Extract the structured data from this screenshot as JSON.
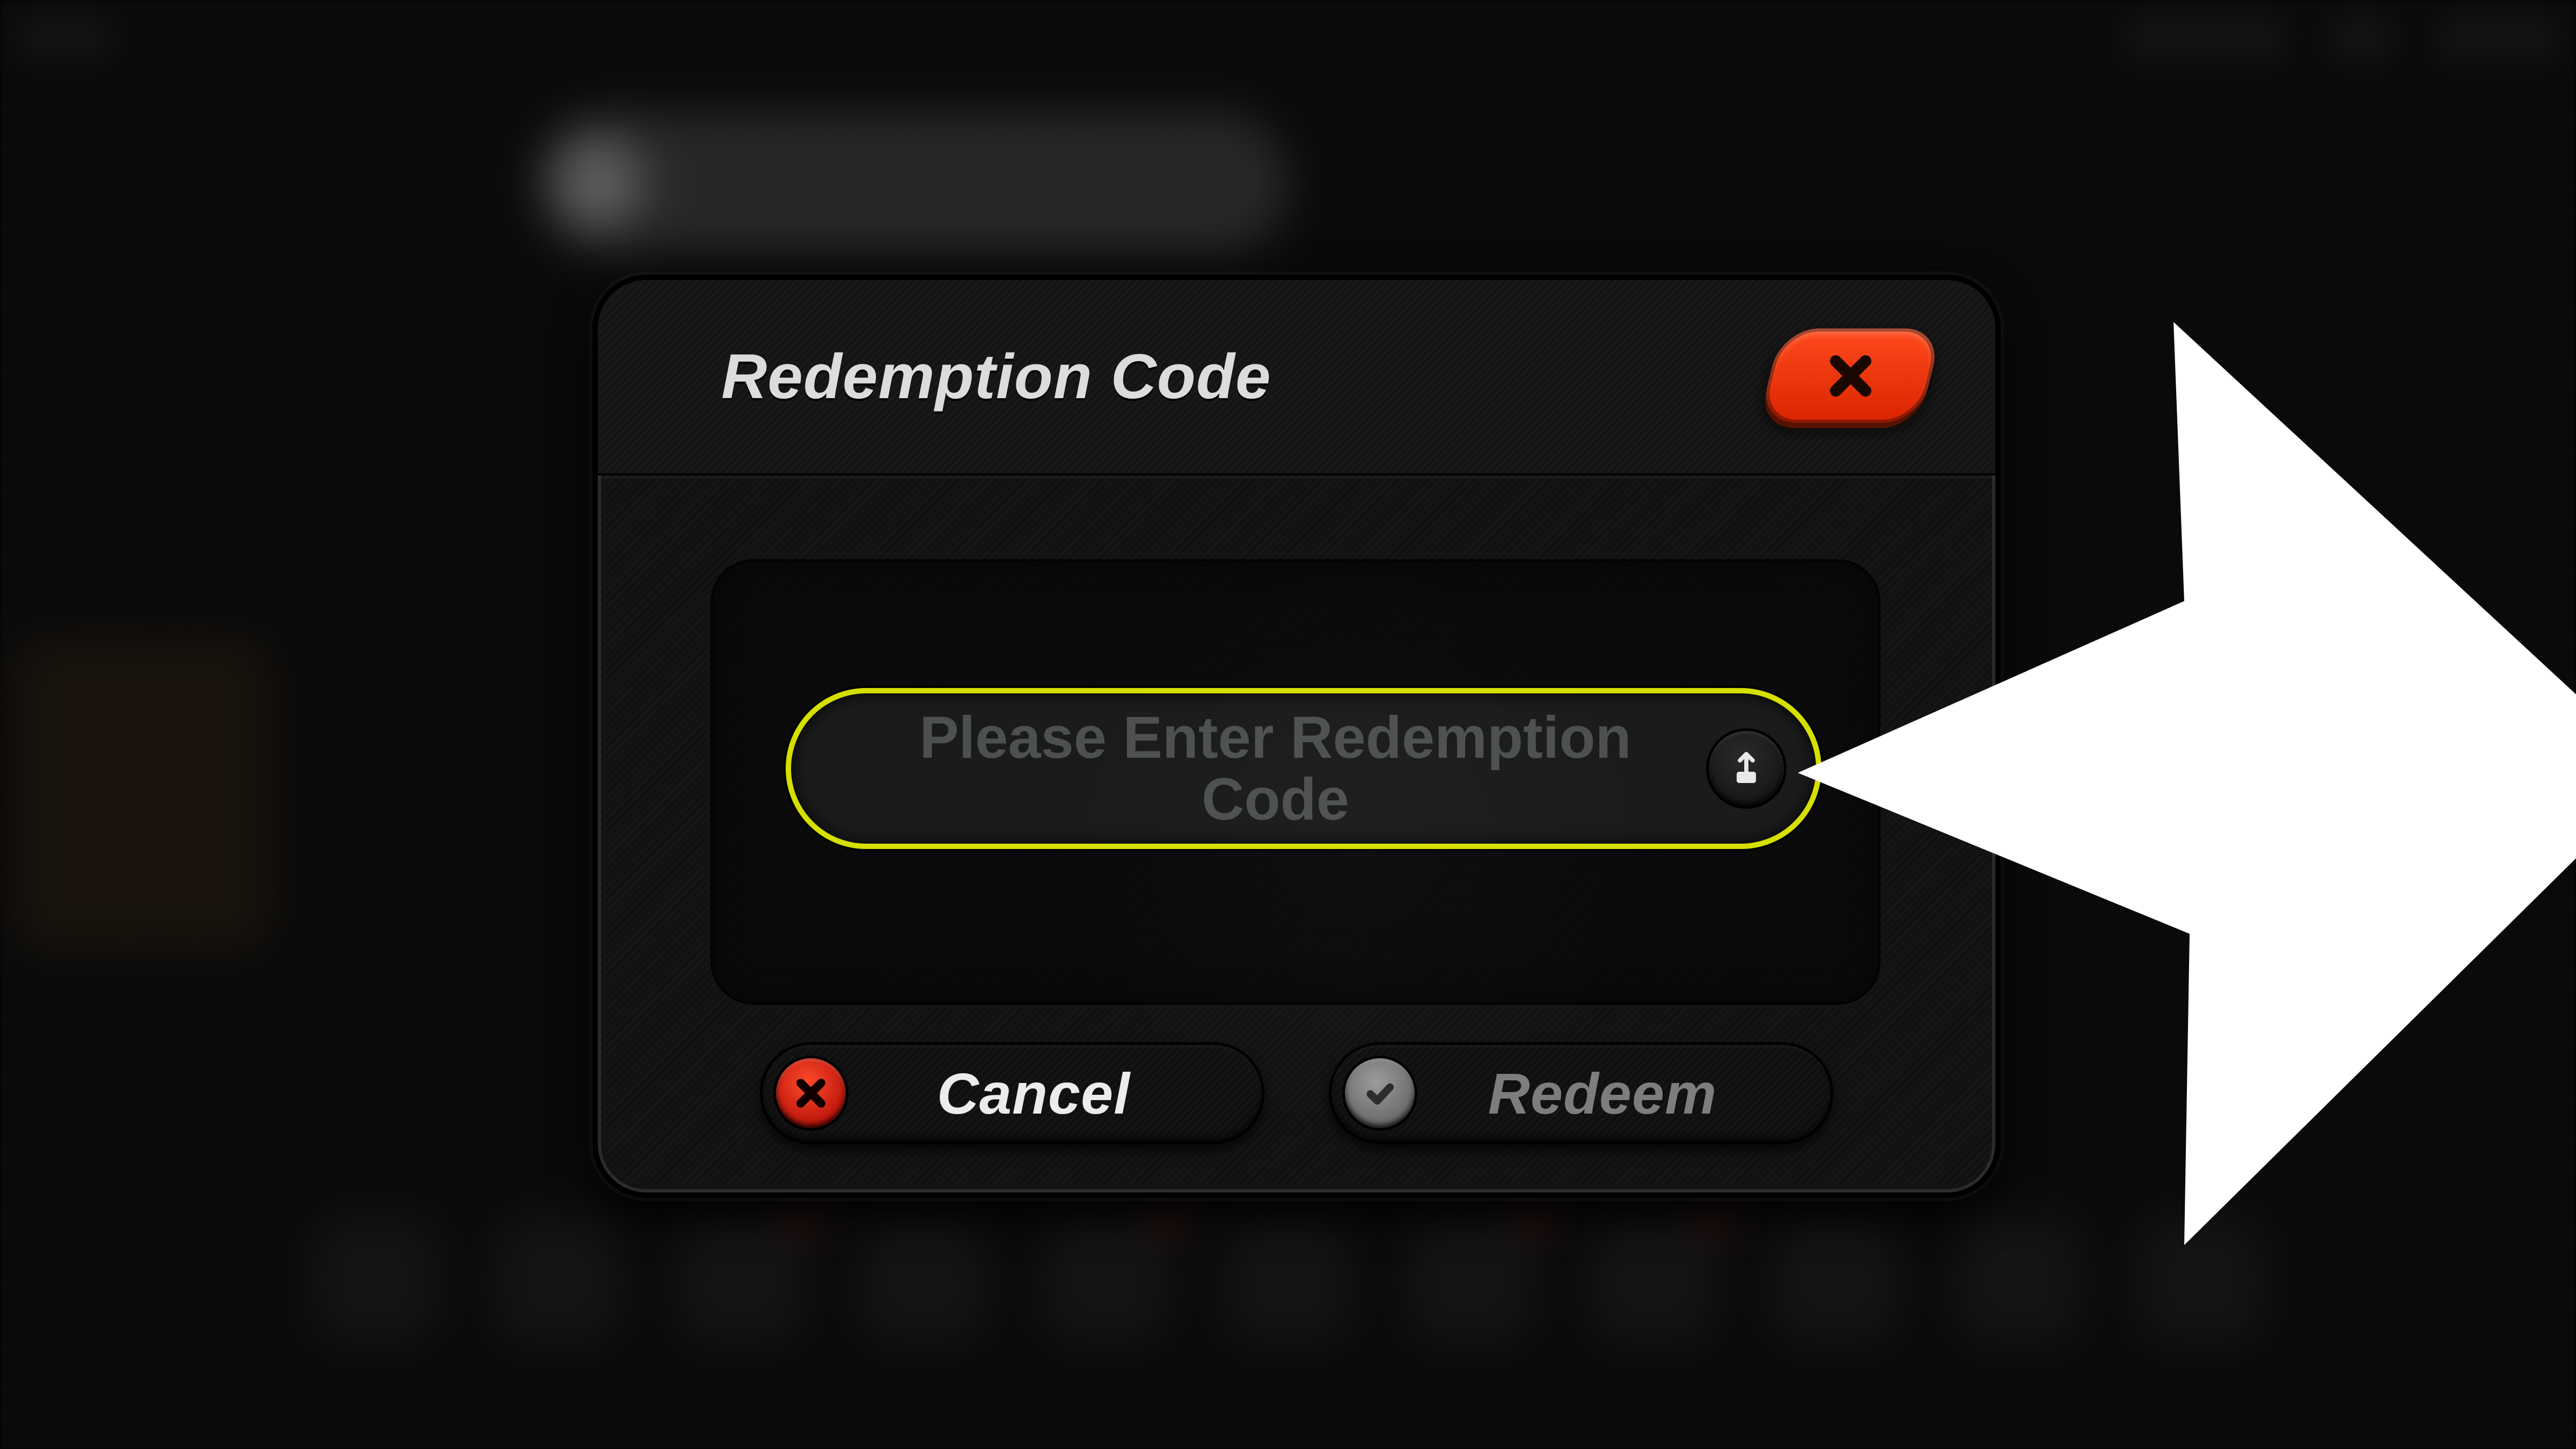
{
  "dialog": {
    "title": "Redemption Code",
    "code_entry": {
      "placeholder": "Please Enter Redemption Code",
      "value": ""
    },
    "paste_label": "paste",
    "buttons": {
      "cancel": "Cancel",
      "redeem": "Redeem"
    },
    "close_label": "close"
  },
  "colors": {
    "accent_red": "#e8381d",
    "accent_yellow": "#d6df00",
    "text_light": "#ececec",
    "text_muted": "#7d7d7d",
    "placeholder": "#4d5050"
  }
}
